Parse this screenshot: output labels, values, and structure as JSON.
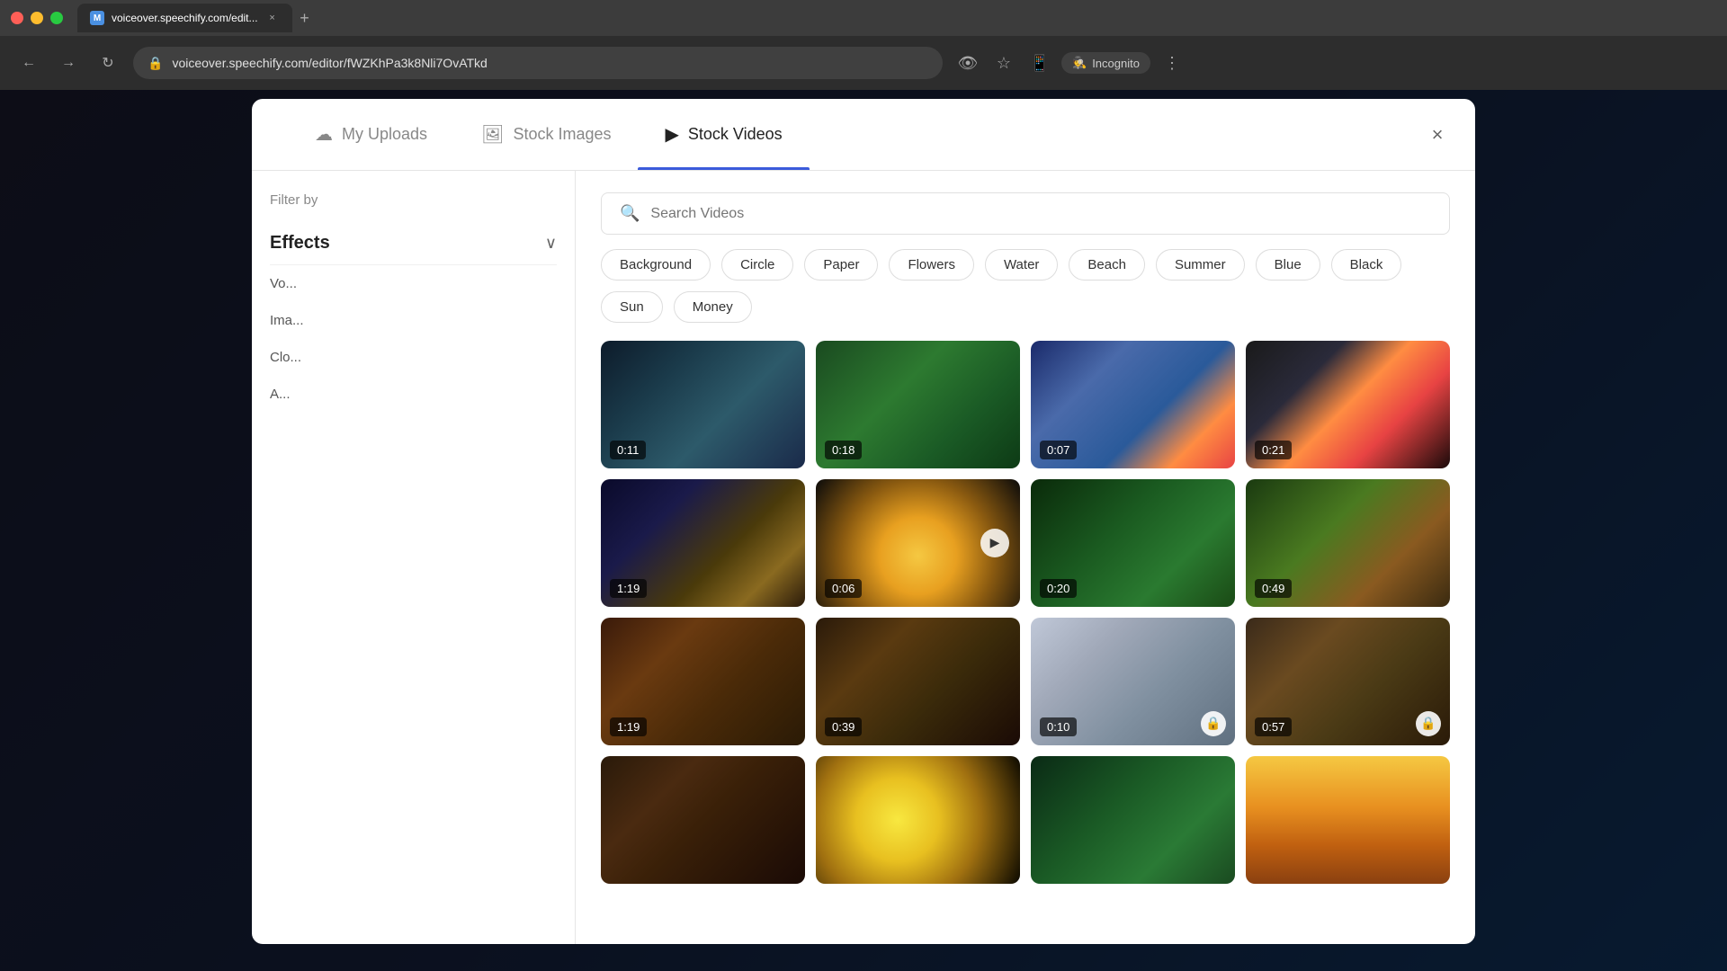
{
  "browser": {
    "url": "voiceover.speechify.com/editor/fWZKhPa3k8Nli7OvATkd",
    "tab_title": "voiceover.speechify.com/edit...",
    "favicon": "M",
    "incognito_label": "Incognito"
  },
  "modal": {
    "close_icon": "×",
    "tabs": [
      {
        "id": "my-uploads",
        "label": "My Uploads",
        "icon": "☁"
      },
      {
        "id": "stock-images",
        "label": "Stock Images",
        "icon": "🖼"
      },
      {
        "id": "stock-videos",
        "label": "Stock Videos",
        "icon": "▶",
        "active": true
      }
    ]
  },
  "sidebar": {
    "filter_by_label": "Filter by",
    "effects_label": "Effects",
    "items": [
      {
        "id": "voice",
        "label": "Vo..."
      },
      {
        "id": "images",
        "label": "Ima..."
      },
      {
        "id": "clone",
        "label": "Clo..."
      },
      {
        "id": "ai",
        "label": "A..."
      }
    ]
  },
  "search": {
    "placeholder": "Search Videos"
  },
  "filter_tags": [
    {
      "id": "background",
      "label": "Background"
    },
    {
      "id": "circle",
      "label": "Circle"
    },
    {
      "id": "paper",
      "label": "Paper"
    },
    {
      "id": "flowers",
      "label": "Flowers"
    },
    {
      "id": "water",
      "label": "Water"
    },
    {
      "id": "beach",
      "label": "Beach"
    },
    {
      "id": "summer",
      "label": "Summer"
    },
    {
      "id": "blue",
      "label": "Blue"
    },
    {
      "id": "black",
      "label": "Black"
    },
    {
      "id": "sun",
      "label": "Sun"
    },
    {
      "id": "money",
      "label": "Money"
    }
  ],
  "videos": [
    {
      "id": 1,
      "duration": "0:11",
      "bg": "video-bg-1",
      "locked": false
    },
    {
      "id": 2,
      "duration": "0:18",
      "bg": "video-bg-2",
      "locked": false
    },
    {
      "id": 3,
      "duration": "0:07",
      "bg": "video-bg-3",
      "locked": false
    },
    {
      "id": 4,
      "duration": "0:21",
      "bg": "video-bg-4",
      "locked": false
    },
    {
      "id": 5,
      "duration": "1:19",
      "bg": "video-bg-5",
      "locked": false
    },
    {
      "id": 6,
      "duration": "0:06",
      "bg": "video-bg-6",
      "locked": false,
      "playing": true
    },
    {
      "id": 7,
      "duration": "0:20",
      "bg": "video-bg-7",
      "locked": false
    },
    {
      "id": 8,
      "duration": "0:49",
      "bg": "video-bg-8",
      "locked": false
    },
    {
      "id": 9,
      "duration": "1:19",
      "bg": "video-bg-9",
      "locked": false
    },
    {
      "id": 10,
      "duration": "0:39",
      "bg": "video-bg-10",
      "locked": false
    },
    {
      "id": 11,
      "duration": "0:10",
      "bg": "video-bg-11",
      "locked": true
    },
    {
      "id": 12,
      "duration": "0:57",
      "bg": "video-bg-12",
      "locked": true
    },
    {
      "id": 13,
      "duration": "",
      "bg": "video-bg-13",
      "locked": false
    },
    {
      "id": 14,
      "duration": "",
      "bg": "video-bg-14",
      "locked": false
    },
    {
      "id": 15,
      "duration": "",
      "bg": "video-bg-15",
      "locked": false
    },
    {
      "id": 16,
      "duration": "",
      "bg": "video-bg-16",
      "locked": false
    }
  ],
  "icons": {
    "back": "←",
    "forward": "→",
    "refresh": "↻",
    "lock": "🔒",
    "star": "☆",
    "menu": "⋮",
    "close": "×",
    "search": "🔍",
    "chevron_down": "∨",
    "lock_badge": "🔒",
    "play": "▶"
  }
}
